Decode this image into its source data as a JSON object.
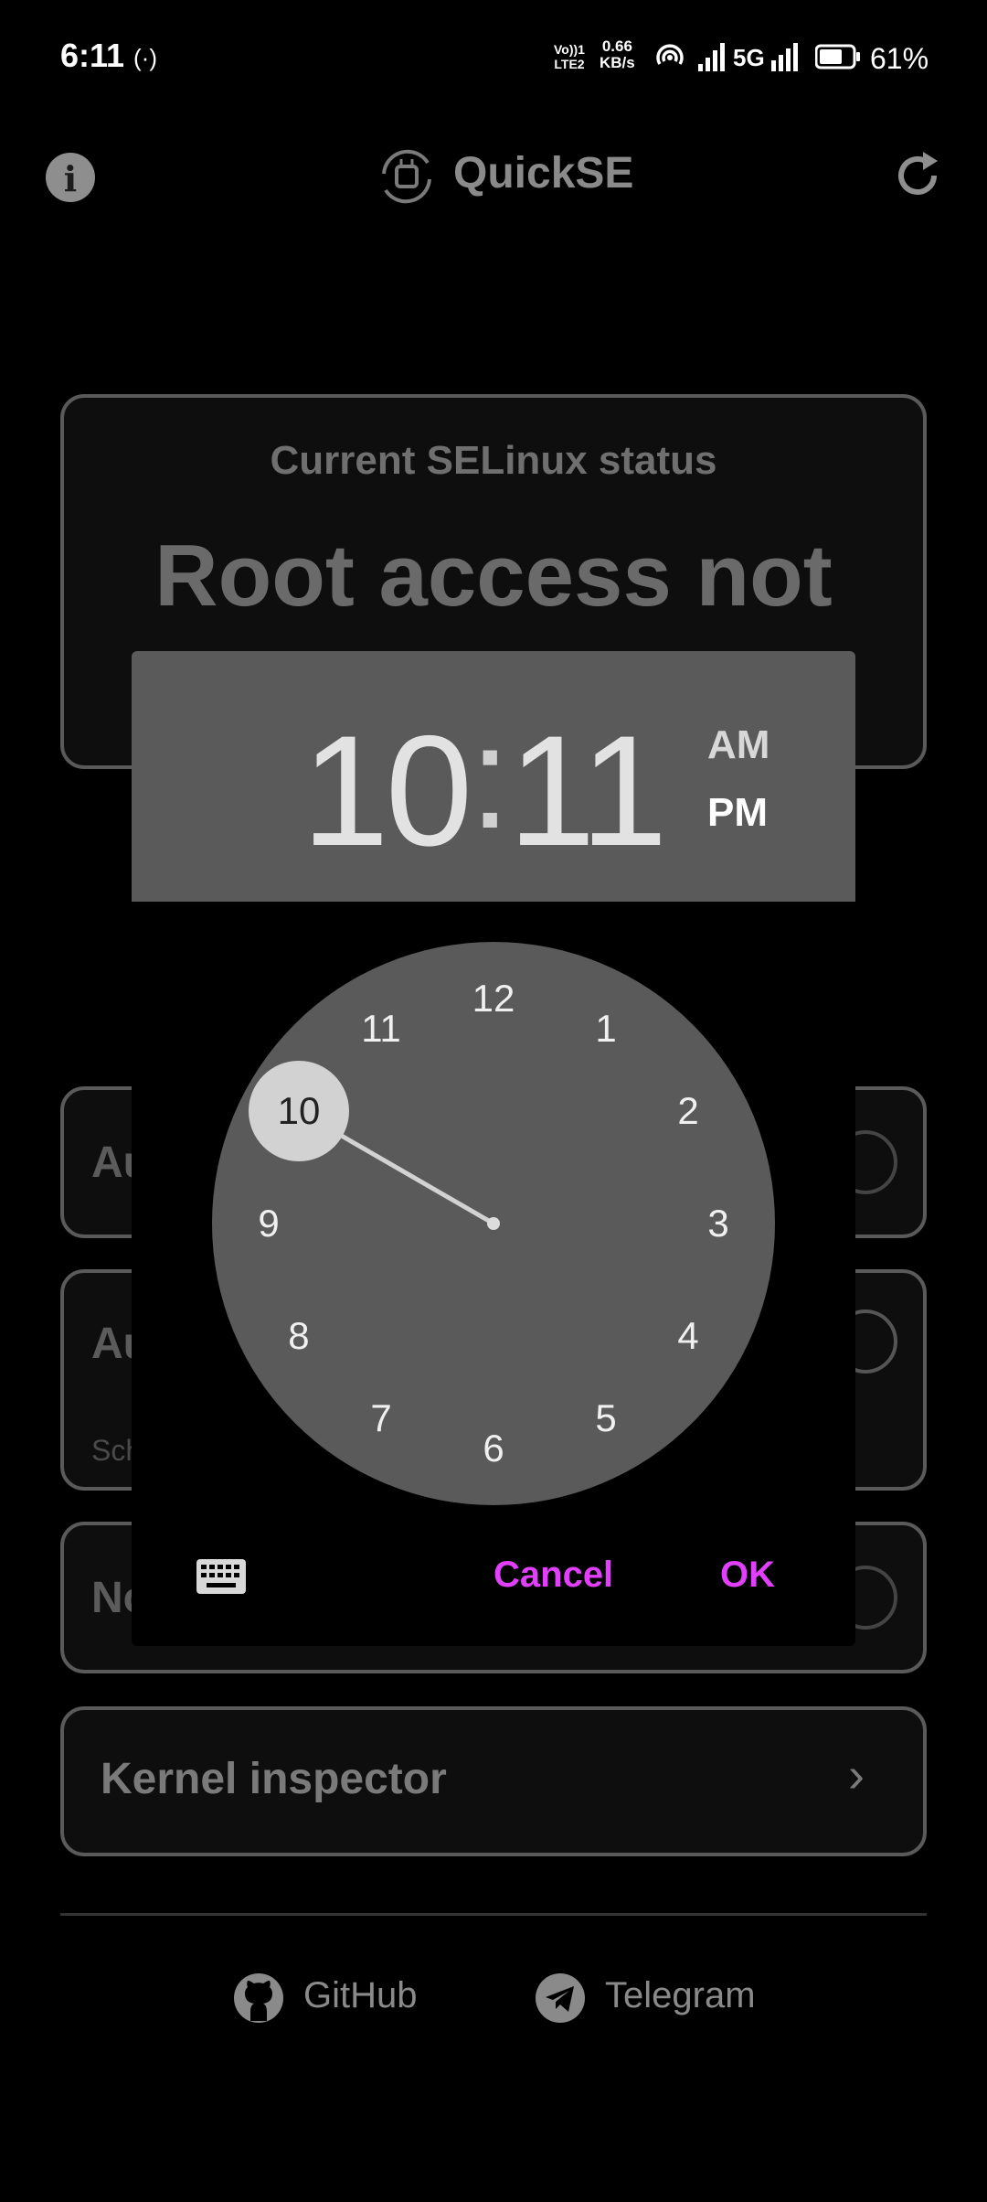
{
  "status_bar": {
    "time": "6:11",
    "volte_top": "Vo))1",
    "volte_bottom": "LTE2",
    "speed_value": "0.66",
    "speed_unit": "KB/s",
    "network": "5G",
    "battery": "61%"
  },
  "app_bar": {
    "title": "QuickSE"
  },
  "status_card": {
    "label": "Current SELinux status",
    "value": "Root access not"
  },
  "options": {
    "item1_partial": "Au",
    "item2_partial": "Au",
    "item2_sub_partial": "Sch",
    "item3_partial": "No"
  },
  "kernel": {
    "label": "Kernel inspector"
  },
  "footer": {
    "github": "GitHub",
    "telegram": "Telegram"
  },
  "time_picker": {
    "hour": "10",
    "colon": ":",
    "minute": "11",
    "am": "AM",
    "pm": "PM",
    "selected_period": "PM",
    "selected_hour": 10,
    "clock_numbers": [
      "12",
      "1",
      "2",
      "3",
      "4",
      "5",
      "6",
      "7",
      "8",
      "9",
      "10",
      "11"
    ],
    "cancel": "Cancel",
    "ok": "OK"
  },
  "colors": {
    "accent": "#e040fb",
    "header_bg": "#5a5a5a"
  }
}
